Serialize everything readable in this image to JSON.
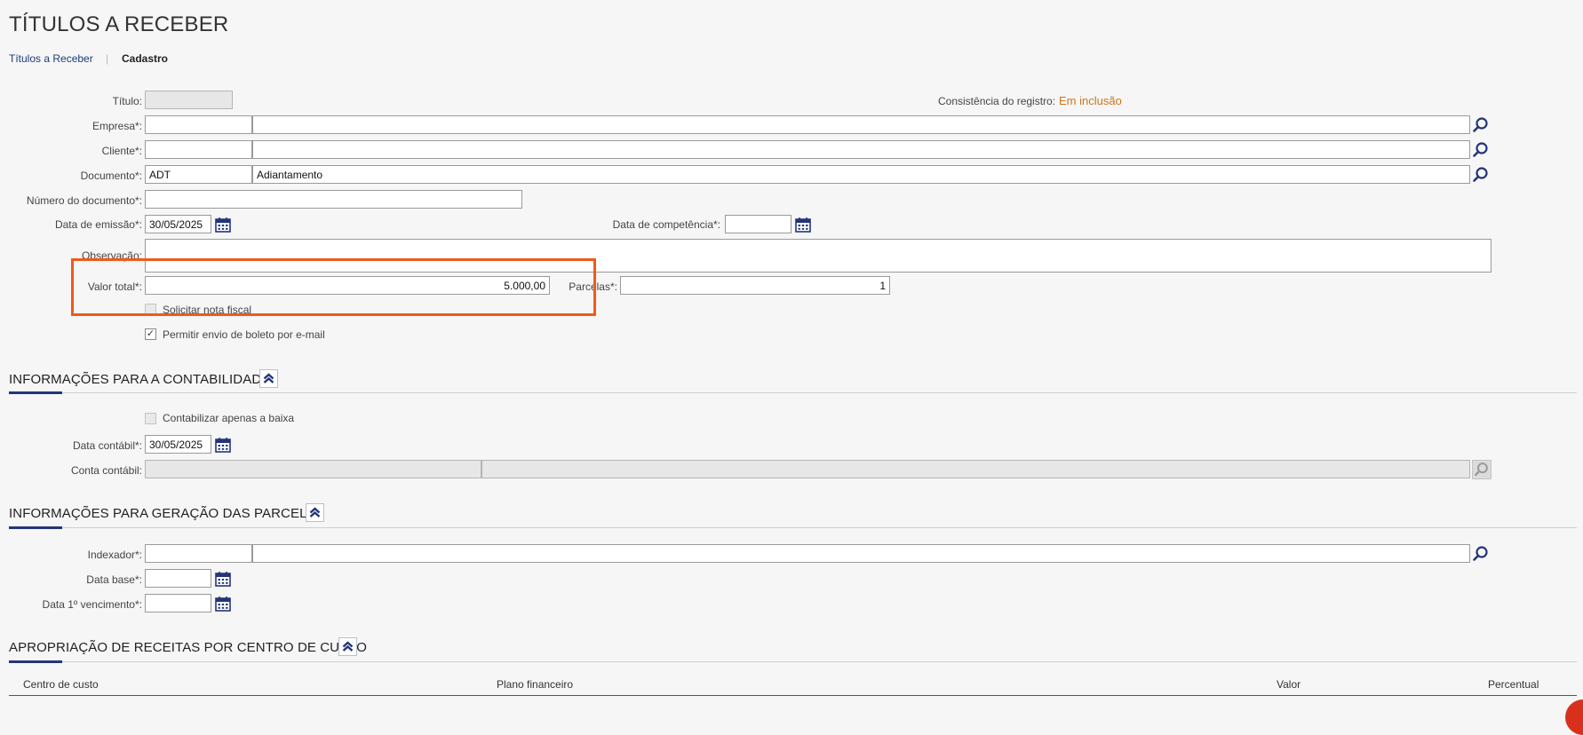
{
  "page": {
    "title": "TÍTULOS A RECEBER"
  },
  "breadcrumb": {
    "link": "Títulos a Receber",
    "separator": "|",
    "current": "Cadastro"
  },
  "form": {
    "titulo_label": "Título:",
    "titulo_value": "",
    "consistencia_label": "Consistência do registro:",
    "consistencia_value": "Em inclusão",
    "empresa_label": "Empresa*:",
    "empresa_code": "",
    "empresa_name": "",
    "cliente_label": "Cliente*:",
    "cliente_code": "",
    "cliente_name": "",
    "documento_label": "Documento*:",
    "documento_code": "ADT",
    "documento_name": "Adiantamento",
    "numero_label": "Número do documento*:",
    "numero_value": "",
    "emissao_label": "Data de emissão*:",
    "emissao_value": "30/05/2025",
    "competencia_label": "Data de competência*:",
    "competencia_value": "",
    "observacao_label": "Observação:",
    "observacao_value": "",
    "valor_total_label": "Valor total*:",
    "valor_total_value": "5.000,00",
    "parcelas_label": "Parcelas*:",
    "parcelas_value": "1",
    "solicitar_nf_label": "Solicitar nota fiscal",
    "solicitar_nf_checked": false,
    "boleto_email_label": "Permitir envio de boleto por e-mail",
    "boleto_email_checked": true
  },
  "contabilidade": {
    "title": "INFORMAÇÕES PARA A CONTABILIDADE",
    "contabilizar_label": "Contabilizar apenas a baixa",
    "contabilizar_checked": false,
    "data_contabil_label": "Data contábil*:",
    "data_contabil_value": "30/05/2025",
    "conta_contabil_label": "Conta contábil:",
    "conta_code": "",
    "conta_name": ""
  },
  "parcelas": {
    "title": "INFORMAÇÕES PARA GERAÇÃO DAS PARCELAS",
    "indexador_label": "Indexador*:",
    "indexador_code": "",
    "indexador_name": "",
    "data_base_label": "Data base*:",
    "data_base_value": "",
    "venc_label": "Data 1º vencimento*:",
    "venc_value": ""
  },
  "apropriacao": {
    "title": "APROPRIAÇÃO DE RECEITAS POR CENTRO DE CUSTO",
    "columns": [
      "Centro de custo",
      "Plano financeiro",
      "Valor",
      "Percentual"
    ]
  },
  "colors": {
    "accent": "#23357a",
    "highlight": "#f05a1a",
    "status": "#c9761d",
    "link": "#1d3a7a"
  },
  "icons": {
    "search": "search-icon",
    "calendar": "calendar-icon",
    "collapse": "chevron-double-up-icon"
  }
}
